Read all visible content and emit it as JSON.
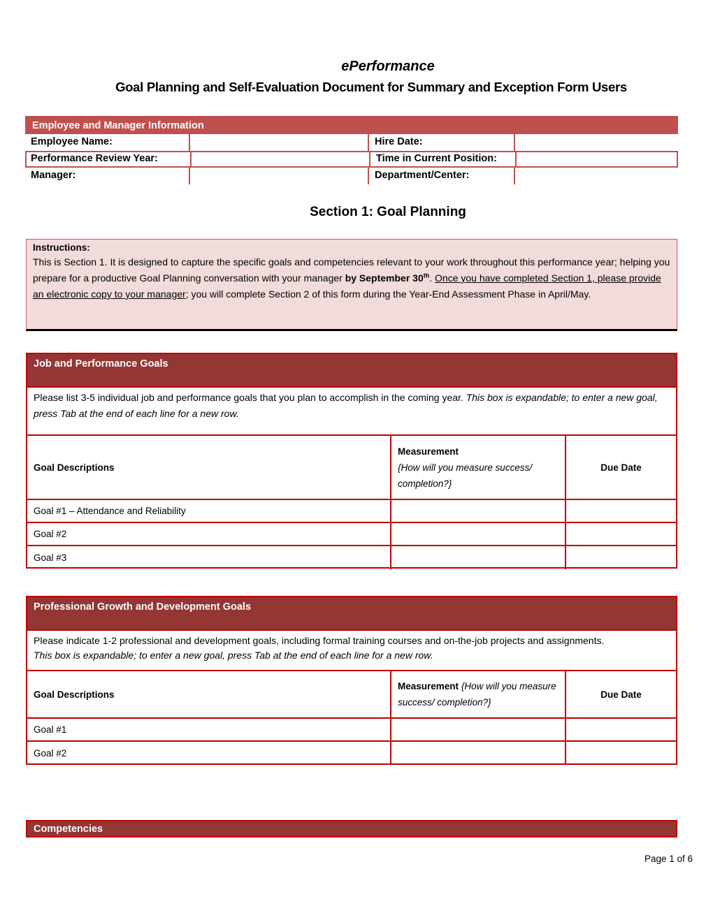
{
  "header": {
    "app_name": "ePerformance",
    "document_title": "Goal Planning and Self-Evaluation Document for Summary and Exception Form Users"
  },
  "employee_info": {
    "title": "Employee and Manager Information",
    "rows": [
      {
        "label_left": "Employee Name:",
        "value_left": "",
        "label_right": "Hire Date:",
        "value_right": ""
      },
      {
        "label_left": "Performance Review Year:",
        "value_left": "",
        "label_right": "Time in Current Position:",
        "value_right": ""
      },
      {
        "label_left": "Manager:",
        "value_left": "",
        "label_right": "Department/Center:",
        "value_right": ""
      }
    ]
  },
  "section_title": "Section 1:  Goal Planning",
  "instructions": {
    "heading": "Instructions:",
    "text_1": "This is Section 1.  It is designed to capture the specific goals and competencies relevant to your work throughout this performance year; helping you prepare for a productive Goal Planning conversation with your manager ",
    "bold_deadline": "by September 30",
    "bold_deadline_sup": "th",
    "text_2": ".  ",
    "underlined": "Once you have completed Section 1, please provide an electronic copy to your manager",
    "text_3": "; you will complete Section 2 of this form during the Year-End Assessment Phase in April/May."
  },
  "job_goals": {
    "title": "Job and Performance Goals",
    "description": "Please list 3-5 individual job and performance goals that you plan to accomplish in the coming year. ",
    "description_italic": "This box is expandable; to enter a new goal, press Tab at the end of each line for a new row.",
    "columns": {
      "goal": "Goal Descriptions",
      "measurement": "Measurement",
      "measurement_hint": "{How will you measure success/ completion?}",
      "due_date": "Due Date"
    },
    "rows": [
      {
        "goal": "Goal #1 – Attendance and Reliability",
        "measurement": "",
        "due_date": ""
      },
      {
        "goal": "Goal #2",
        "measurement": "",
        "due_date": ""
      },
      {
        "goal": "Goal #3",
        "measurement": "",
        "due_date": ""
      }
    ]
  },
  "professional_goals": {
    "title": "Professional Growth and Development Goals",
    "description": "Please indicate 1-2 professional and development goals, including formal training courses and on-the-job projects and assignments.",
    "description_italic": "This box is expandable; to enter a new goal, press Tab at the end of each line for a new row.",
    "columns": {
      "goal": "Goal Descriptions",
      "measurement": "Measurement",
      "measurement_hint": "{How will you measure success/ completion?}",
      "due_date": "Due Date"
    },
    "rows": [
      {
        "goal": "Goal #1",
        "measurement": "",
        "due_date": ""
      },
      {
        "goal": "Goal #2",
        "measurement": "",
        "due_date": ""
      }
    ]
  },
  "competencies": {
    "title": "Competencies"
  },
  "footer": {
    "page_label": "Page 1 of 6"
  },
  "colors": {
    "info_header": "#c0504d",
    "section_header": "#943634",
    "table_border": "#c00000",
    "instructions_bg": "#f2dcdb"
  }
}
